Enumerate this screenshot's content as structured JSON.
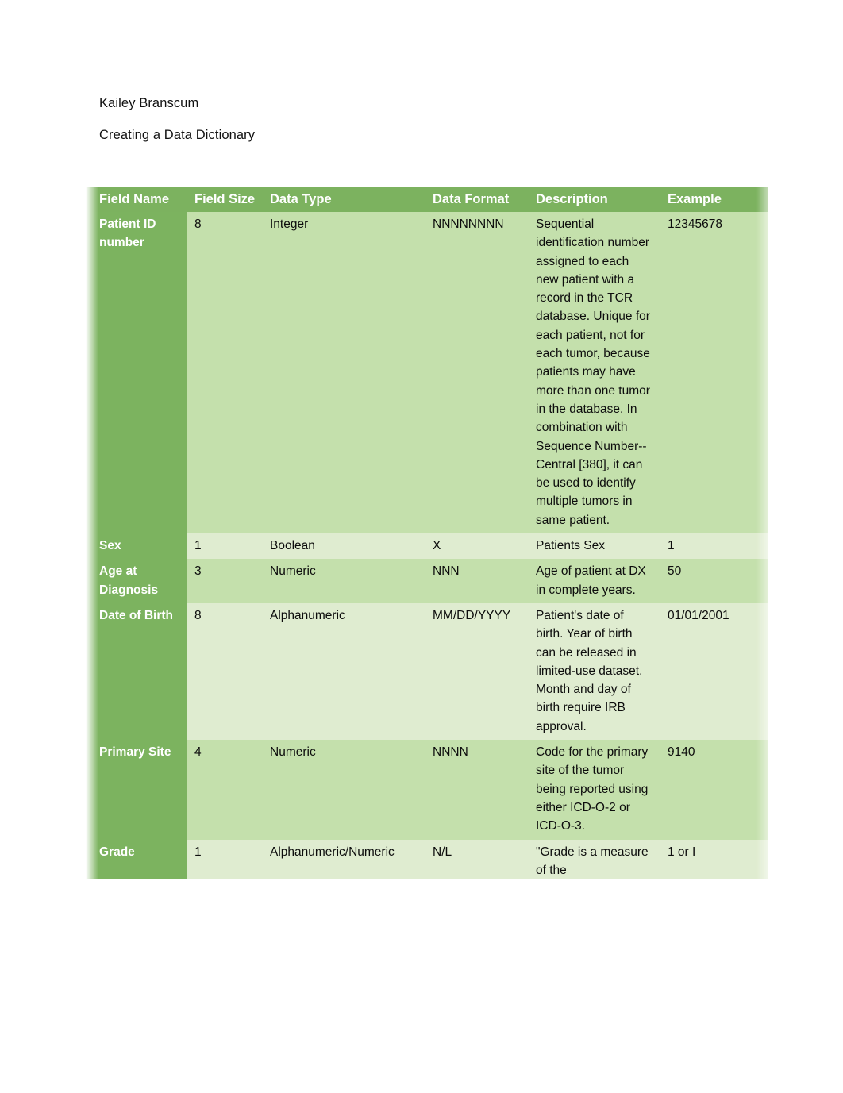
{
  "document": {
    "author": "Kailey Branscum",
    "title": "Creating a Data Dictionary"
  },
  "theme": {
    "header_green": "#7cb25f",
    "first_column_green": "#7cb35f",
    "row_band_dark": "#c4e0ac",
    "row_band_light": "#dfecd0",
    "header_text": "#ffffff",
    "body_text": "#0d0d0d",
    "page_background": "#ffffff"
  },
  "table": {
    "columns": [
      "Field Name",
      "Field Size",
      "Data Type",
      "Data Format",
      "Description",
      "Example"
    ],
    "rows": [
      {
        "field_name": "Patient ID number",
        "field_size": "8",
        "data_type": "Integer",
        "data_format": "NNNNNNNN",
        "description": "Sequential identification number assigned to each new patient with a record in the TCR database. Unique for each patient, not for each tumor, because patients may have more than one tumor in the database. In combination with Sequence Number--Central [380], it can be used to identify multiple tumors in same patient.",
        "example": "12345678"
      },
      {
        "field_name": "Sex",
        "field_size": "1",
        "data_type": "Boolean",
        "data_format": "X",
        "description": "Patients Sex",
        "example": "1"
      },
      {
        "field_name": "Age at Diagnosis",
        "field_size": "3",
        "data_type": "Numeric",
        "data_format": "NNN",
        "description": "Age of patient at DX in complete years.",
        "example": "50"
      },
      {
        "field_name": "Date of Birth",
        "field_size": "8",
        "data_type": "Alphanumeric",
        "data_format": "MM/DD/YYYY",
        "description": "Patient's date of birth. Year of birth can be released in limited-use dataset. Month and day of birth require IRB approval.",
        "example": "01/01/2001"
      },
      {
        "field_name": "Primary Site",
        "field_size": "4",
        "data_type": "Numeric",
        "data_format": "NNNN",
        "description": "Code for the primary site of the tumor being reported using either ICD-O-2 or ICD-O-3.",
        "example": "9140"
      },
      {
        "field_name": "Grade",
        "field_size": "1",
        "data_type": "Alphanumeric/Numeric",
        "data_format": "N/L",
        "description": "\"Grade is a measure of the",
        "example": "1 or I"
      }
    ]
  }
}
